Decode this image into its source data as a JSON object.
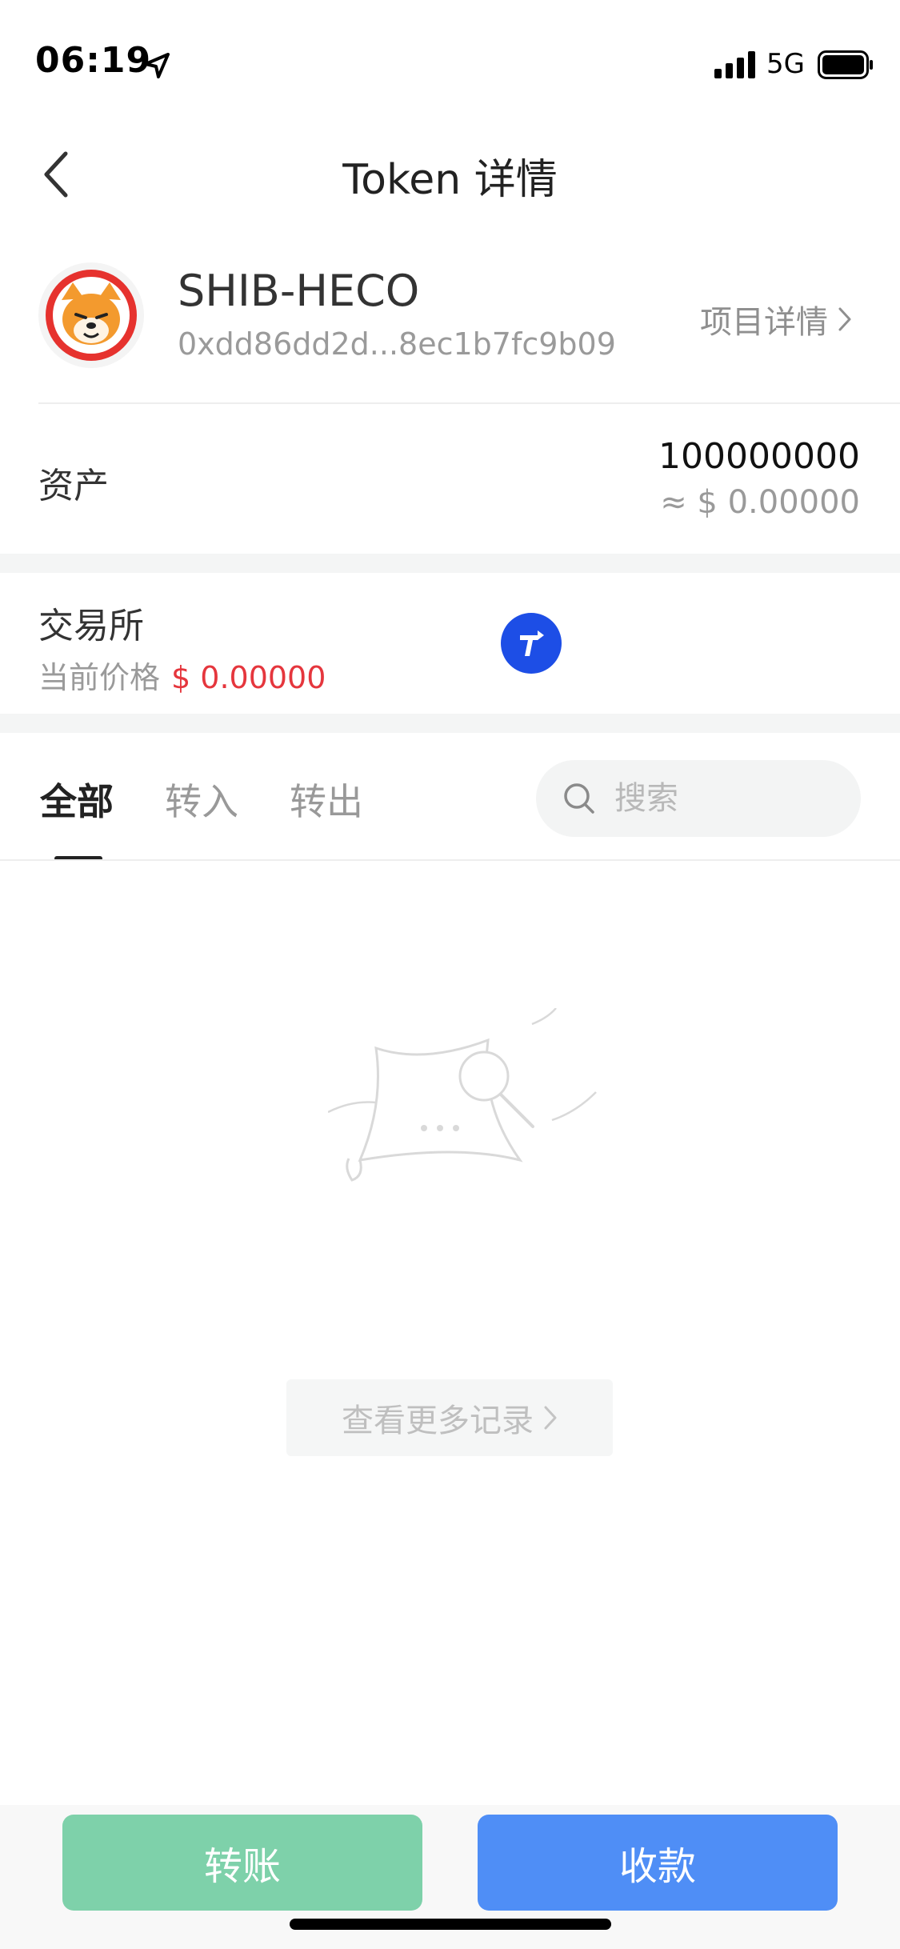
{
  "status_bar": {
    "time": "06:19",
    "network": "5G"
  },
  "nav": {
    "title": "Token 详情"
  },
  "token": {
    "name": "SHIB-HECO",
    "address": "0xdd86dd2d...8ec1b7fc9b09",
    "project_link": "项目详情"
  },
  "assets": {
    "label": "资产",
    "amount": "100000000",
    "fiat": "≈ $ 0.00000"
  },
  "exchange": {
    "label": "交易所",
    "price_label": "当前价格",
    "price_value": "$ 0.00000"
  },
  "tabs": [
    {
      "label": "全部",
      "active": true
    },
    {
      "label": "转入",
      "active": false
    },
    {
      "label": "转出",
      "active": false
    }
  ],
  "search": {
    "placeholder": "搜索"
  },
  "records": {
    "more_label": "查看更多记录"
  },
  "actions": {
    "transfer_label": "转账",
    "receive_label": "收款"
  },
  "colors": {
    "transfer_button": "#7ed1aa",
    "receive_button": "#4f8ef6",
    "price_red": "#e5363d",
    "exchange_icon": "#1d4ee6"
  }
}
